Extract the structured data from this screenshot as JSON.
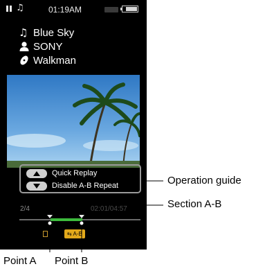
{
  "status_bar": {
    "time": "01:19AM",
    "icons": [
      "pause-icon",
      "music-note-icon",
      "battery-icon"
    ]
  },
  "track": {
    "title": "Blue Sky",
    "artist": "SONY",
    "album": "Walkman",
    "icons": [
      "music-note-icon",
      "artist-icon",
      "album-icon"
    ]
  },
  "operation_guide": {
    "items": [
      {
        "button": "up",
        "label": "Quick Replay"
      },
      {
        "button": "down",
        "label": "Disable A-B Repeat"
      }
    ]
  },
  "playback": {
    "track_position": "2/4",
    "time": "02:01/04:57",
    "mode_badge": "⇆ A-B"
  },
  "callouts": {
    "operation_guide": "Operation guide",
    "section_ab": "Section A-B",
    "point_a": "Point A",
    "point_b": "Point B"
  },
  "colors": {
    "screen_bg": "#000000",
    "section_highlight": "#3dbb3d",
    "ab_badge": "#e2a91b",
    "guide_border": "#9a9a9a"
  }
}
